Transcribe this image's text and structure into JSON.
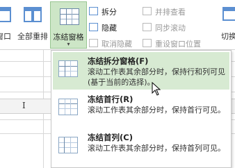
{
  "ribbon": {
    "window_partial_label": "窗口",
    "arrange_all_label": "全部重排",
    "freeze_panes_label": "冻结窗格",
    "split_label": "拆分",
    "hide_label": "隐藏",
    "unhide_label": "取消隐藏",
    "view_side_by_side_label": "并排查看",
    "sync_scroll_label": "同步滚动",
    "reset_position_label": "重设窗口位置",
    "switch_partial_label": "切换"
  },
  "menu": {
    "items": [
      {
        "title": "冻结拆分窗格(F)",
        "desc": "滚动工作表其余部分时，保持行和列可见(基于当前的选择)。",
        "highlighted": true
      },
      {
        "title": "冻结首行(R)",
        "desc": "滚动工作表其余部分时，保持首行可见。",
        "highlighted": false
      },
      {
        "title": "冻结首列(C)",
        "desc": "滚动工作表其余部分时，保持首列可见。",
        "highlighted": false
      }
    ]
  },
  "sheet": {
    "col_left": "I",
    "col_right": "M"
  },
  "colors": {
    "accent": "#5b8fd1",
    "highlight": "#d7ead2",
    "freeze_button_bg": "#cde6c7"
  }
}
